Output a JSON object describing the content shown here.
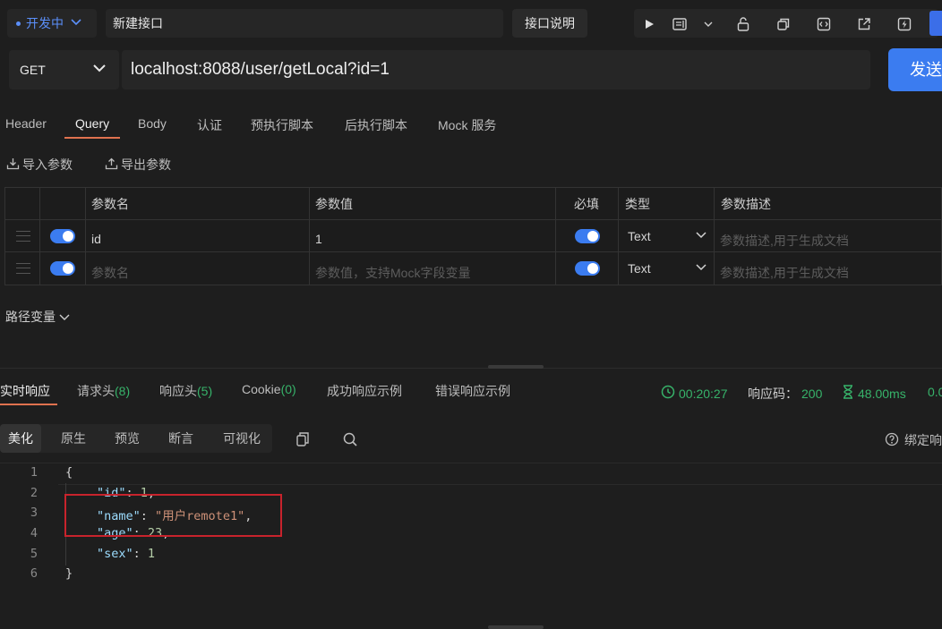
{
  "topbar": {
    "env_label": "开发中",
    "name_value": "新建接口",
    "doc_button": "接口说明",
    "tools": [
      "play-icon",
      "doc-icon",
      "chevron-down-icon",
      "unlock-icon",
      "copy-icon",
      "code-icon",
      "share-icon",
      "flash-icon"
    ]
  },
  "request": {
    "method": "GET",
    "url": "localhost:8088/user/getLocal?id=1",
    "send_label": "发送"
  },
  "req_tabs": [
    "Header",
    "Query",
    "Body",
    "认证",
    "预执行脚本",
    "后执行脚本",
    "Mock 服务"
  ],
  "req_active_tab": "Query",
  "actions": {
    "import": "导入参数",
    "export": "导出参数"
  },
  "params": {
    "headers": {
      "name": "参数名",
      "value": "参数值",
      "required": "必填",
      "type": "类型",
      "desc": "参数描述"
    },
    "rows": [
      {
        "name": "id",
        "value": "1",
        "enabled": true,
        "required": true,
        "type": "Text",
        "desc_placeholder": "参数描述,用于生成文档"
      }
    ],
    "empty_row": {
      "name_placeholder": "参数名",
      "value_placeholder": "参数值，支持Mock字段变量",
      "enabled": true,
      "required": true,
      "type": "Text",
      "desc_placeholder": "参数描述,用于生成文档"
    }
  },
  "path_var_label": "路径变量",
  "response": {
    "tabs": [
      {
        "label": "实时响应"
      },
      {
        "label": "请求头",
        "count": "(8)"
      },
      {
        "label": "响应头",
        "count": "(5)"
      },
      {
        "label": "Cookie",
        "count": "(0)"
      },
      {
        "label": "成功响应示例"
      },
      {
        "label": "错误响应示例"
      }
    ],
    "time": "00:20:27",
    "code_label": "响应码：",
    "code": "200",
    "duration": "48.00ms",
    "size": "0.0",
    "view_modes": [
      "美化",
      "原生",
      "预览",
      "断言",
      "可视化"
    ],
    "active_view": "美化",
    "bind_label": "绑定响",
    "body_lines": [
      {
        "n": "1",
        "text": "{"
      },
      {
        "n": "2",
        "key": "\"id\"",
        "val": "1",
        "type": "num",
        "comma": true
      },
      {
        "n": "3",
        "key": "\"name\"",
        "val": "\"用户remote1\"",
        "type": "str",
        "comma": true
      },
      {
        "n": "4",
        "key": "\"age\"",
        "val": "23",
        "type": "num",
        "comma": true
      },
      {
        "n": "5",
        "key": "\"sex\"",
        "val": "1",
        "type": "num",
        "comma": false
      },
      {
        "n": "6",
        "text": "}"
      }
    ]
  },
  "colors": {
    "accent": "#3b7cf0",
    "tab_underline": "#e0724f",
    "success": "#37b36a",
    "highlight_box": "#c8232c"
  }
}
